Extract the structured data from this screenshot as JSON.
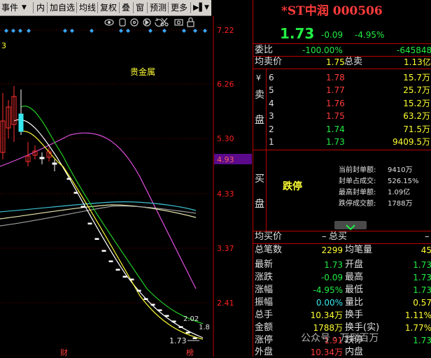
{
  "toolbar": {
    "items": [
      "事件",
      "内",
      "加自选",
      "均线",
      "复权",
      "叠",
      "窗",
      "预测",
      "更多"
    ],
    "first_dropdown_icon": "chevron-down-icon",
    "more_dropdown_icon": "chevron-down-icon",
    "play_icon": "play-icon"
  },
  "chart": {
    "corner_label": "3",
    "sector_label": "贵金属",
    "price_axis": [
      "7.22",
      "6.26",
      "5.30",
      "4.93",
      "4.33",
      "3.37",
      "2.41"
    ],
    "current_price_tag": "4.93",
    "low_marker": "1.73",
    "right_low_labels": [
      "2.02",
      "1.8"
    ],
    "bottom_markers": [
      "财",
      "榜"
    ],
    "tool_icons": [
      "eye-icon",
      "hand-icon",
      "target-icon",
      "play-circle-icon",
      "undo-icon",
      "scissors-icon",
      "camera-icon",
      "lock-icon"
    ]
  },
  "quote": {
    "title": "*ST中润 000506",
    "price": "1.73",
    "change": "-0.09",
    "change_pct": "-4.95%",
    "wei_bi_label": "委比",
    "wei_bi_value": "-100.00%",
    "wei_cha_value": "-645848",
    "avg_sell_label": "均卖价",
    "avg_sell_value": "1.75",
    "total_sell_label": "总卖",
    "total_sell_value": "1.13亿",
    "sell_side_label": [
      "¥",
      "卖",
      "盘"
    ],
    "asks": [
      {
        "level": "6",
        "price": "1.78",
        "volume": "15.7万"
      },
      {
        "level": "5",
        "price": "1.77",
        "volume": "25.7万"
      },
      {
        "level": "4",
        "price": "1.76",
        "volume": "15.2万"
      },
      {
        "level": "3",
        "price": "1.75",
        "volume": "63.2万"
      },
      {
        "level": "2",
        "price": "1.74",
        "volume": "71.5万"
      },
      {
        "level": "1",
        "price": "1.73",
        "volume": "9409.5万"
      }
    ],
    "buy_side_label": [
      "买",
      "盘"
    ],
    "limit_status": "跌停",
    "seal_info": [
      {
        "label": "当前封单额:",
        "value": "9410万"
      },
      {
        "label": "封单占成交:",
        "value": "526.15%"
      },
      {
        "label": "最高封单额:",
        "value": "1.09亿"
      },
      {
        "label": "跌停成交额:",
        "value": "1788万"
      }
    ],
    "expand_icon": "chevron-down-icon",
    "avg_buy_label": "均买价",
    "avg_buy_value": "–",
    "total_buy_label": "总买",
    "total_buy_value": "–",
    "stats_left": [
      {
        "label": "总笔数",
        "value": "2299"
      },
      {
        "label": "最新",
        "value": "1.73"
      },
      {
        "label": "涨跌",
        "value": "-0.09"
      },
      {
        "label": "涨幅",
        "value": "-4.95%"
      },
      {
        "label": "振幅",
        "value": "0.00%"
      },
      {
        "label": "总手",
        "value": "10.34万"
      },
      {
        "label": "金额",
        "value": "1788万"
      },
      {
        "label": "涨停",
        "value": "1.91"
      },
      {
        "label": "外盘",
        "value": "10.34万"
      }
    ],
    "stats_right": [
      {
        "label": "均笔量",
        "value": "45"
      },
      {
        "label": "开盘",
        "value": "1.73"
      },
      {
        "label": "最高",
        "value": "1.73"
      },
      {
        "label": "最低",
        "value": "1.73"
      },
      {
        "label": "量比",
        "value": "0.57"
      },
      {
        "label": "换手",
        "value": "1.11%"
      },
      {
        "label": "换手(实)",
        "value": "1.77%"
      },
      {
        "label": "跌停",
        "value": "1.73"
      },
      {
        "label": "内盘",
        "value": ""
      }
    ],
    "watermark": "公众号 · 万到百万"
  },
  "colors": {
    "up": "#ff3b3b",
    "down": "#22ee44",
    "neutral": "#e0e0e0",
    "highlight": "#ffff33",
    "axis_red": "#ff2020",
    "price_tag_bg": "#5a0a8a"
  }
}
